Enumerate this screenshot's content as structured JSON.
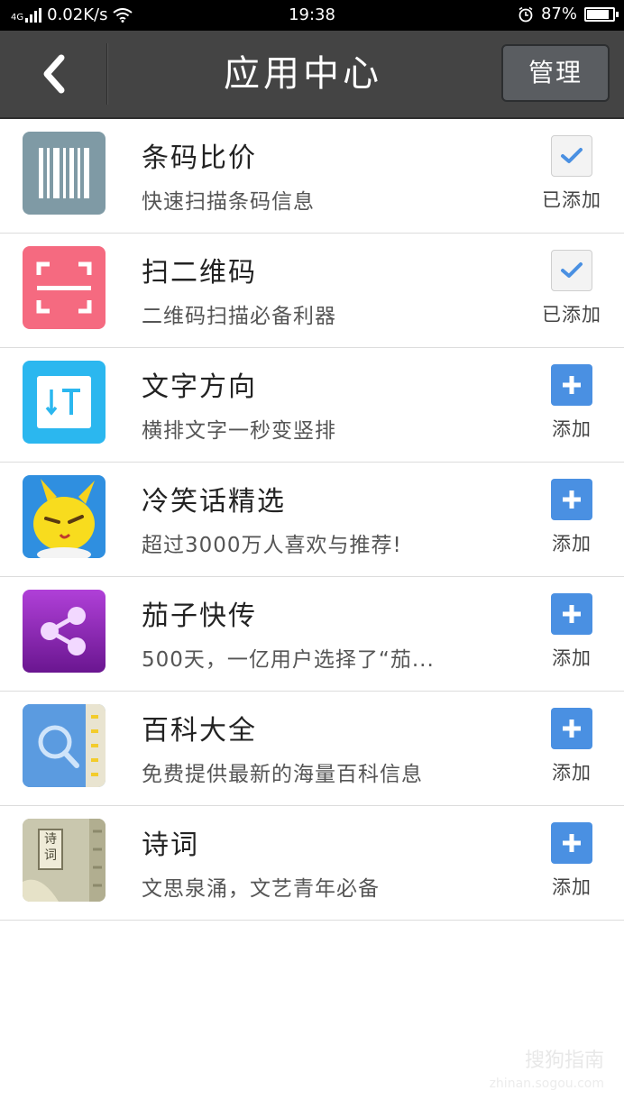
{
  "status_bar": {
    "network_type": "4G",
    "speed": "0.02K/s",
    "time": "19:38",
    "battery_percent": "87%",
    "battery_level": 0.87,
    "icons": [
      "signal-icon",
      "wifi-icon",
      "alarm-icon",
      "battery-icon"
    ]
  },
  "header": {
    "back_icon": "chevron-left-icon",
    "title": "应用中心",
    "manage_label": "管理"
  },
  "apps": [
    {
      "name": "条码比价",
      "desc": "快速扫描条码信息",
      "status": "added",
      "action_label": "已添加",
      "icon": "barcode-icon",
      "icon_color": "#7f9aa5"
    },
    {
      "name": "扫二维码",
      "desc": "二维码扫描必备利器",
      "status": "added",
      "action_label": "已添加",
      "icon": "qr-scan-icon",
      "icon_color": "#f56a80"
    },
    {
      "name": "文字方向",
      "desc": "横排文字一秒变竖排",
      "status": "add",
      "action_label": "添加",
      "icon": "text-direction-icon",
      "icon_color": "#2bb7ef"
    },
    {
      "name": "冷笑话精选",
      "desc": "超过3000万人喜欢与推荐!",
      "status": "add",
      "action_label": "添加",
      "icon": "rabbit-mascot-icon",
      "icon_color": "#2f8fe0"
    },
    {
      "name": "茄子快传",
      "desc": "500天，一亿用户选择了“茄...",
      "status": "add",
      "action_label": "添加",
      "icon": "share-icon",
      "icon_color": "#8e26b8"
    },
    {
      "name": "百科大全",
      "desc": "免费提供最新的海量百科信息",
      "status": "add",
      "action_label": "添加",
      "icon": "encyclopedia-book-icon",
      "icon_color": "#5b9be0"
    },
    {
      "name": "诗词",
      "desc": "文思泉涌，文艺青年必备",
      "status": "add",
      "action_label": "添加",
      "icon": "poetry-book-icon",
      "icon_color": "#c9c7ae",
      "icon_text": "诗词"
    }
  ],
  "colors": {
    "status_bar_bg": "#000000",
    "title_bar_bg": "#444444",
    "add_button": "#4a90e2",
    "check_mark": "#4a90e2"
  },
  "watermark": {
    "text": "搜狗指南",
    "sub": "zhinan.sogou.com"
  }
}
